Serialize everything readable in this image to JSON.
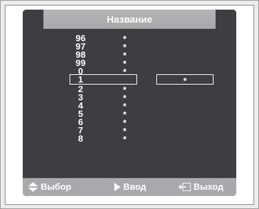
{
  "menu": {
    "title": "Название",
    "rows": [
      {
        "num": "96",
        "mark": "*"
      },
      {
        "num": "97",
        "mark": "*"
      },
      {
        "num": "98",
        "mark": "*"
      },
      {
        "num": "99",
        "mark": "*"
      },
      {
        "num": "0",
        "mark": "*"
      },
      {
        "num": "1",
        "mark": ""
      },
      {
        "num": "2",
        "mark": "*"
      },
      {
        "num": "3",
        "mark": "*"
      },
      {
        "num": "4",
        "mark": "*"
      },
      {
        "num": "5",
        "mark": "*"
      },
      {
        "num": "6",
        "mark": "*"
      },
      {
        "num": "7",
        "mark": "*"
      },
      {
        "num": "8",
        "mark": "*"
      }
    ],
    "selected_index": 5,
    "edit_value": "*"
  },
  "footer": {
    "select_label": "Выбор",
    "enter_label": "Ввод",
    "exit_label": "Выход",
    "icons": [
      "up-down-arrows-icon",
      "play-icon",
      "exit-icon"
    ]
  },
  "colors": {
    "panel": "#3e3e42",
    "header_tab": "#b5b5b8",
    "footer": "#a9a9ad",
    "text": "#ffffff"
  }
}
